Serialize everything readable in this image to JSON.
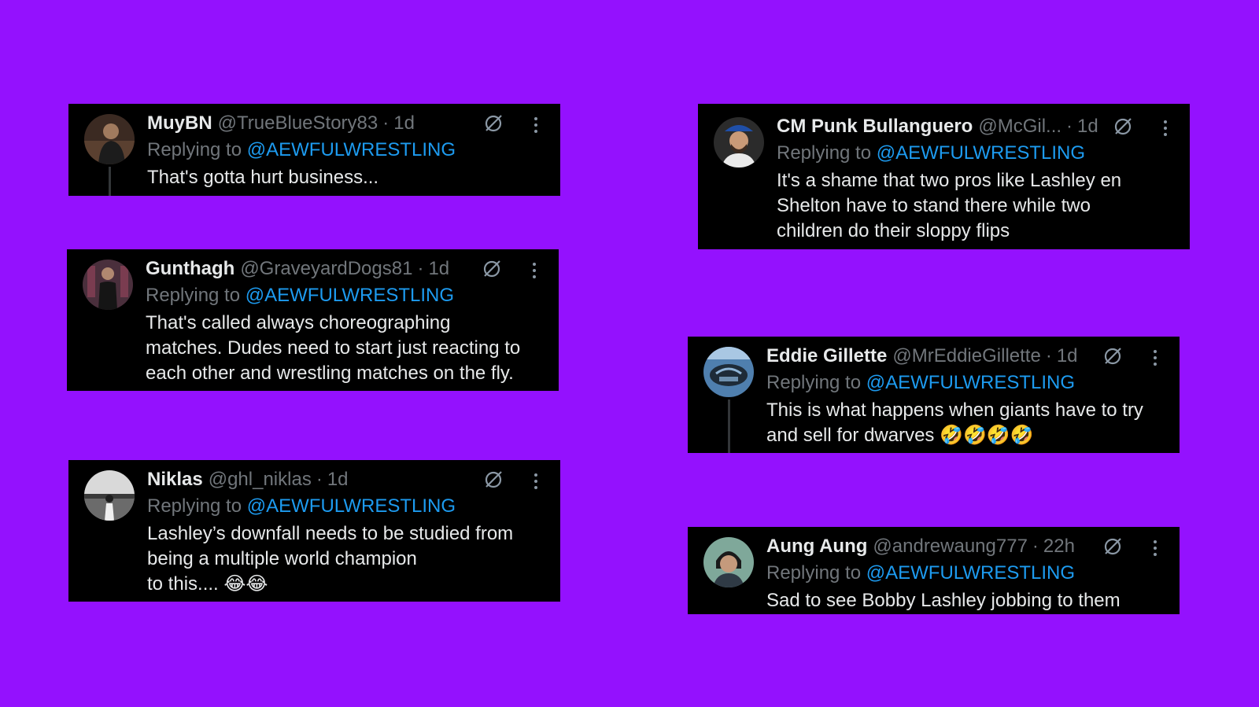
{
  "replying_label": "Replying to",
  "tweets": [
    {
      "name": "MuyBN",
      "handle": "@TrueBlueStory83",
      "time": "1d",
      "reply_to": "@AEWFULWRESTLING",
      "text": "That's gotta hurt business..."
    },
    {
      "name": "Gunthagh",
      "handle": "@GraveyardDogs81",
      "time": "1d",
      "reply_to": "@AEWFULWRESTLING",
      "text": "That's called always choreographing\nmatches. Dudes need to start just reacting to\neach other and wrestling matches on the fly."
    },
    {
      "name": "Niklas",
      "handle": "@ghl_niklas",
      "time": "1d",
      "reply_to": "@AEWFULWRESTLING",
      "text": "Lashley’s downfall needs to be studied from\nbeing a multiple world champion\n to this.... 😂😂"
    },
    {
      "name": "CM Punk Bullanguero",
      "handle": "@McGil...",
      "time": "1d",
      "reply_to": "@AEWFULWRESTLING",
      "text": "It's a shame that two pros like Lashley en\nShelton have to stand there while two\nchildren do their sloppy flips"
    },
    {
      "name": "Eddie Gillette",
      "handle": "@MrEddieGillette",
      "time": "1d",
      "reply_to": "@AEWFULWRESTLING",
      "text": "This is what happens when giants have to try\nand sell for dwarves 🤣🤣🤣🤣"
    },
    {
      "name": "Aung Aung",
      "handle": "@andrewaung777",
      "time": "22h",
      "reply_to": "@AEWFULWRESTLING",
      "text": "Sad to see Bobby Lashley jobbing to them"
    }
  ],
  "icons": {
    "grok": "grok-icon",
    "more": "more-options-icon"
  },
  "colors": {
    "background": "#9411fe",
    "card": "#000000",
    "name": "#e7e9ea",
    "muted": "#71767b",
    "link": "#1d9bf0"
  }
}
